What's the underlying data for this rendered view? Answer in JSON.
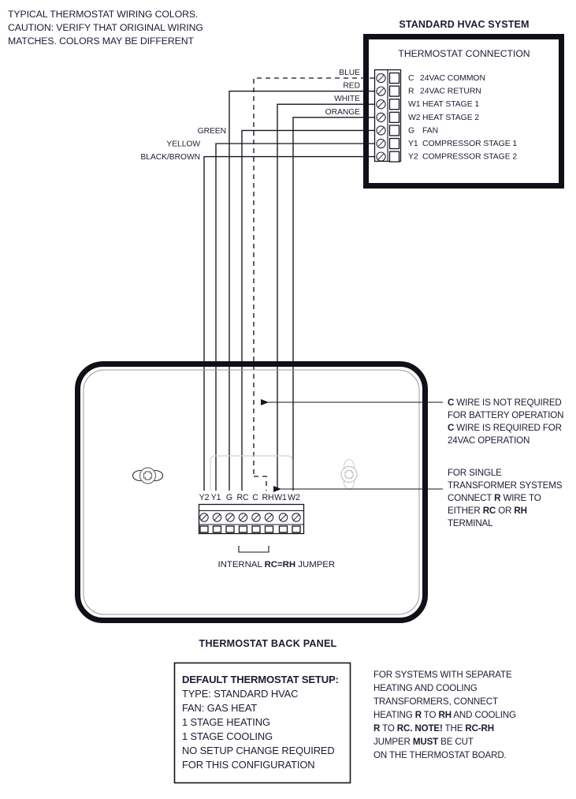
{
  "caption": {
    "line1": "TYPICAL THERMOSTAT WIRING COLORS.",
    "line2": "CAUTION: VERIFY THAT ORIGINAL WIRING",
    "line3": "MATCHES. COLORS MAY BE DIFFERENT"
  },
  "hvac": {
    "title": "STANDARD HVAC SYSTEM",
    "subtitle": "THERMOSTAT CONNECTION",
    "terminals": [
      {
        "code": "C",
        "desc": "24VAC COMMON"
      },
      {
        "code": "R",
        "desc": "24VAC RETURN"
      },
      {
        "code": "W1",
        "desc": "HEAT STAGE 1"
      },
      {
        "code": "W2",
        "desc": "HEAT STAGE 2"
      },
      {
        "code": "G",
        "desc": "FAN"
      },
      {
        "code": "Y1",
        "desc": "COMPRESSOR STAGE 1"
      },
      {
        "code": "Y2",
        "desc": "COMPRESSOR STAGE 2"
      }
    ]
  },
  "wire_labels": {
    "blue": "BLUE",
    "red": "RED",
    "white": "WHITE",
    "orange": "ORANGE",
    "green": "GREEN",
    "yellow": "YELLOW",
    "black_brown": "BLACK/BROWN"
  },
  "backpanel": {
    "caption": "THERMOSTAT BACK PANEL",
    "terminals": [
      "Y2",
      "Y1",
      "G",
      "RC",
      "C",
      "RH",
      "W1",
      "W2"
    ],
    "jumper_pre": "INTERNAL ",
    "jumper_bold": "RC=RH",
    "jumper_post": " JUMPER"
  },
  "notes": {
    "c_wire": [
      {
        "bold": "C",
        "rest": " WIRE IS NOT REQUIRED"
      },
      {
        "bold": "",
        "rest": "FOR BATTERY OPERATION"
      },
      {
        "bold": "C",
        "rest": " WIRE IS REQUIRED FOR"
      },
      {
        "bold": "",
        "rest": "24VAC OPERATION"
      }
    ],
    "single_transformer": [
      "FOR SINGLE",
      "TRANSFORMER SYSTEMS",
      "CONNECT R WIRE TO",
      "EITHER RC OR RH",
      "TERMINAL"
    ],
    "separate_transformer": [
      "FOR SYSTEMS WITH SEPARATE",
      "HEATING AND COOLING",
      "TRANSFORMERS, CONNECT",
      "HEATING R TO RH AND COOLING",
      "R TO RC. NOTE! THE RC-RH",
      "JUMPER MUST BE CUT",
      "ON THE THERMOSTAT BOARD."
    ]
  },
  "setup_box": {
    "title": "DEFAULT THERMOSTAT SETUP:",
    "lines": [
      "TYPE: STANDARD HVAC",
      "FAN: GAS HEAT",
      "1 STAGE HEATING",
      "1 STAGE COOLING",
      "NO SETUP CHANGE REQUIRED",
      "FOR THIS CONFIGURATION"
    ]
  }
}
